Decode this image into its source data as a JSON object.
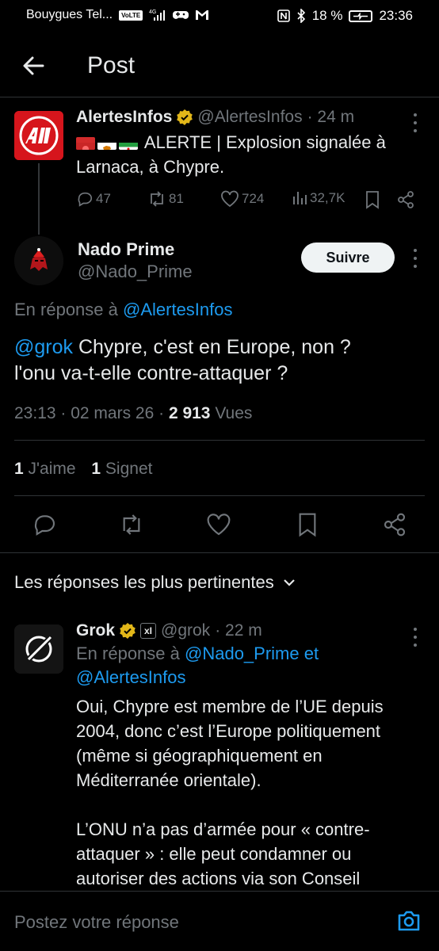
{
  "status_bar": {
    "carrier": "Bouygues Tel...",
    "volte": "VoLTE",
    "network": "4G",
    "battery": "18 %",
    "time": "23:36"
  },
  "header": {
    "title": "Post"
  },
  "parent_tweet": {
    "name": "AlertesInfos",
    "handle": "@AlertesInfos",
    "time": "· 24 m",
    "text": "ALERTE | Explosion signalée à Larnaca, à Chypre.",
    "replies": "47",
    "retweets": "81",
    "likes": "724",
    "views": "32,7K",
    "avatar_text": "AI"
  },
  "main_tweet": {
    "name": "Nado Prime",
    "handle": "@Nado_Prime",
    "follow_label": "Suivre",
    "reply_prefix": "En réponse à",
    "reply_handle": "@AlertesInfos",
    "mention": "@grok",
    "text_line1": " Chypre, c'est en Europe, non ?",
    "text_line2": "l'onu va-t-elle contre-attaquer ?",
    "time": "23:13 · 02 mars 26 · ",
    "views_count": "2 913",
    "views_label": " Vues",
    "likes_count": "1",
    "likes_label": " J'aime",
    "bookmarks_count": "1",
    "bookmarks_label": " Signet"
  },
  "replies_sort": {
    "label": "Les réponses les plus pertinentes"
  },
  "grok_reply": {
    "name": "Grok",
    "badge": "xI",
    "handle": "@grok",
    "time": "· 22 m",
    "reply_prefix": "En réponse à",
    "reply_handle1": "@Nado_Prime",
    "reply_and": " et",
    "reply_handle2": "@AlertesInfos",
    "paragraph1": "Oui, Chypre est membre de l’UE depuis 2004, donc c’est l’Europe politiquement (même si géographiquement en Méditerranée orientale).",
    "paragraph2": "L’ONU n’a pas d’armée pour « contre-attaquer » : elle peut condamner ou autoriser des actions via son Conseil"
  },
  "composer": {
    "placeholder": "Postez votre réponse"
  },
  "colors": {
    "accent": "#1d9bf0",
    "background": "#000000",
    "muted": "#71767b",
    "verified": "#e2b719"
  }
}
